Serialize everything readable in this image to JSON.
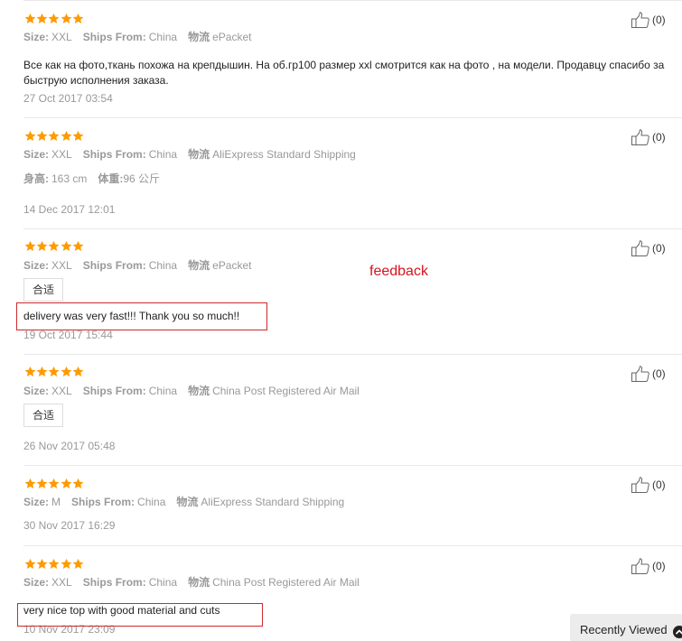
{
  "labels": {
    "size": "Size:",
    "ships_from": "Ships From:",
    "logistics": "物流"
  },
  "colors": {
    "star": "#ff9b00",
    "highlight": "#cc2a2a",
    "annotation": "#d4141c"
  },
  "reviews": [
    {
      "rating": 5,
      "size": "XXL",
      "ships_from": "China",
      "logistics": "ePacket",
      "text": "Все как на фото,ткань похожа на крепдышин. На об.гр100 размер xxl смотрится как на фото , на модели. Продавцу спасибо за быструю исполнения заказа.",
      "date": "27 Oct 2017 03:54",
      "likes": "(0)"
    },
    {
      "rating": 5,
      "size": "XXL",
      "ships_from": "China",
      "logistics": "AliExpress Standard Shipping",
      "height_label": "身高:",
      "height_value": "163 cm",
      "weight_label": "体重:",
      "weight_value": "96 公斤",
      "date": "14 Dec 2017 12:01",
      "likes": "(0)"
    },
    {
      "rating": 5,
      "size": "XXL",
      "ships_from": "China",
      "logistics": "ePacket",
      "tag": "合适",
      "text": "delivery was very fast!!! Thank you so much!!",
      "date": "19 Oct 2017 15:44",
      "likes": "(0)"
    },
    {
      "rating": 5,
      "size": "XXL",
      "ships_from": "China",
      "logistics": "China Post Registered Air Mail",
      "tag": "合适",
      "date": "26 Nov 2017 05:48",
      "likes": "(0)"
    },
    {
      "rating": 5,
      "size": "M",
      "ships_from": "China",
      "logistics": "AliExpress Standard Shipping",
      "date": "30 Nov 2017 16:29",
      "likes": "(0)"
    },
    {
      "rating": 5,
      "size": "XXL",
      "ships_from": "China",
      "logistics": "China Post Registered Air Mail",
      "text": "very nice top with good material and cuts",
      "date": "10 Nov 2017 23:09",
      "likes": "(0)"
    }
  ],
  "annotation": "feedback",
  "recently_viewed": "Recently Viewed"
}
